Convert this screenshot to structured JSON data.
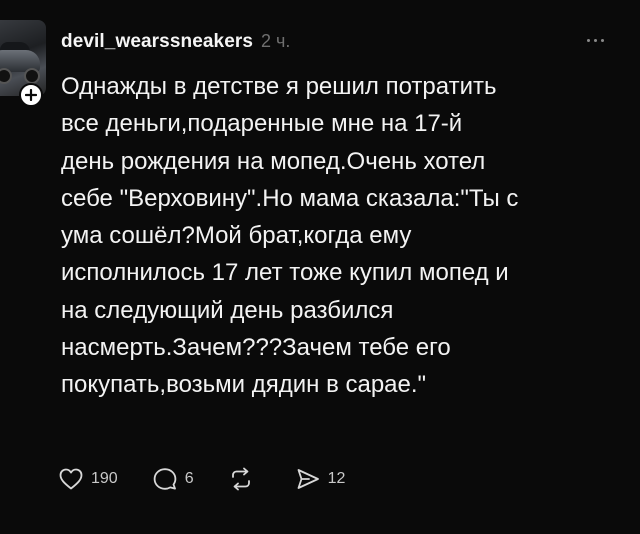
{
  "author": {
    "username": "devil_wearssneakers",
    "time": "2 ч."
  },
  "post": {
    "lines": [
      "Однажды в детстве я решил потратить",
      "все деньги,подаренные мне на 17-й",
      "день рождения на мопед.Очень хотел",
      "себе \"Верховину\".Но мама сказала:\"Ты с",
      "ума сошёл?Мой брат,когда ему",
      "исполнилось 17 лет тоже купил мопед и",
      "на следующий день разбился",
      "насмерть.Зачем???Зачем тебе его",
      "покупать,возьми дядин в сарае.\""
    ]
  },
  "actions": {
    "likes": "190",
    "comments": "6",
    "reposts": "",
    "shares": "12"
  },
  "icons": {
    "like": "heart-icon",
    "comment": "comment-bubble-icon",
    "repost": "repost-icon",
    "share": "send-icon",
    "follow": "plus-icon",
    "more": "more-dots-icon"
  },
  "colors": {
    "background": "#0a0a0a",
    "text": "#f3f3f3",
    "muted": "#6f6f6f"
  }
}
